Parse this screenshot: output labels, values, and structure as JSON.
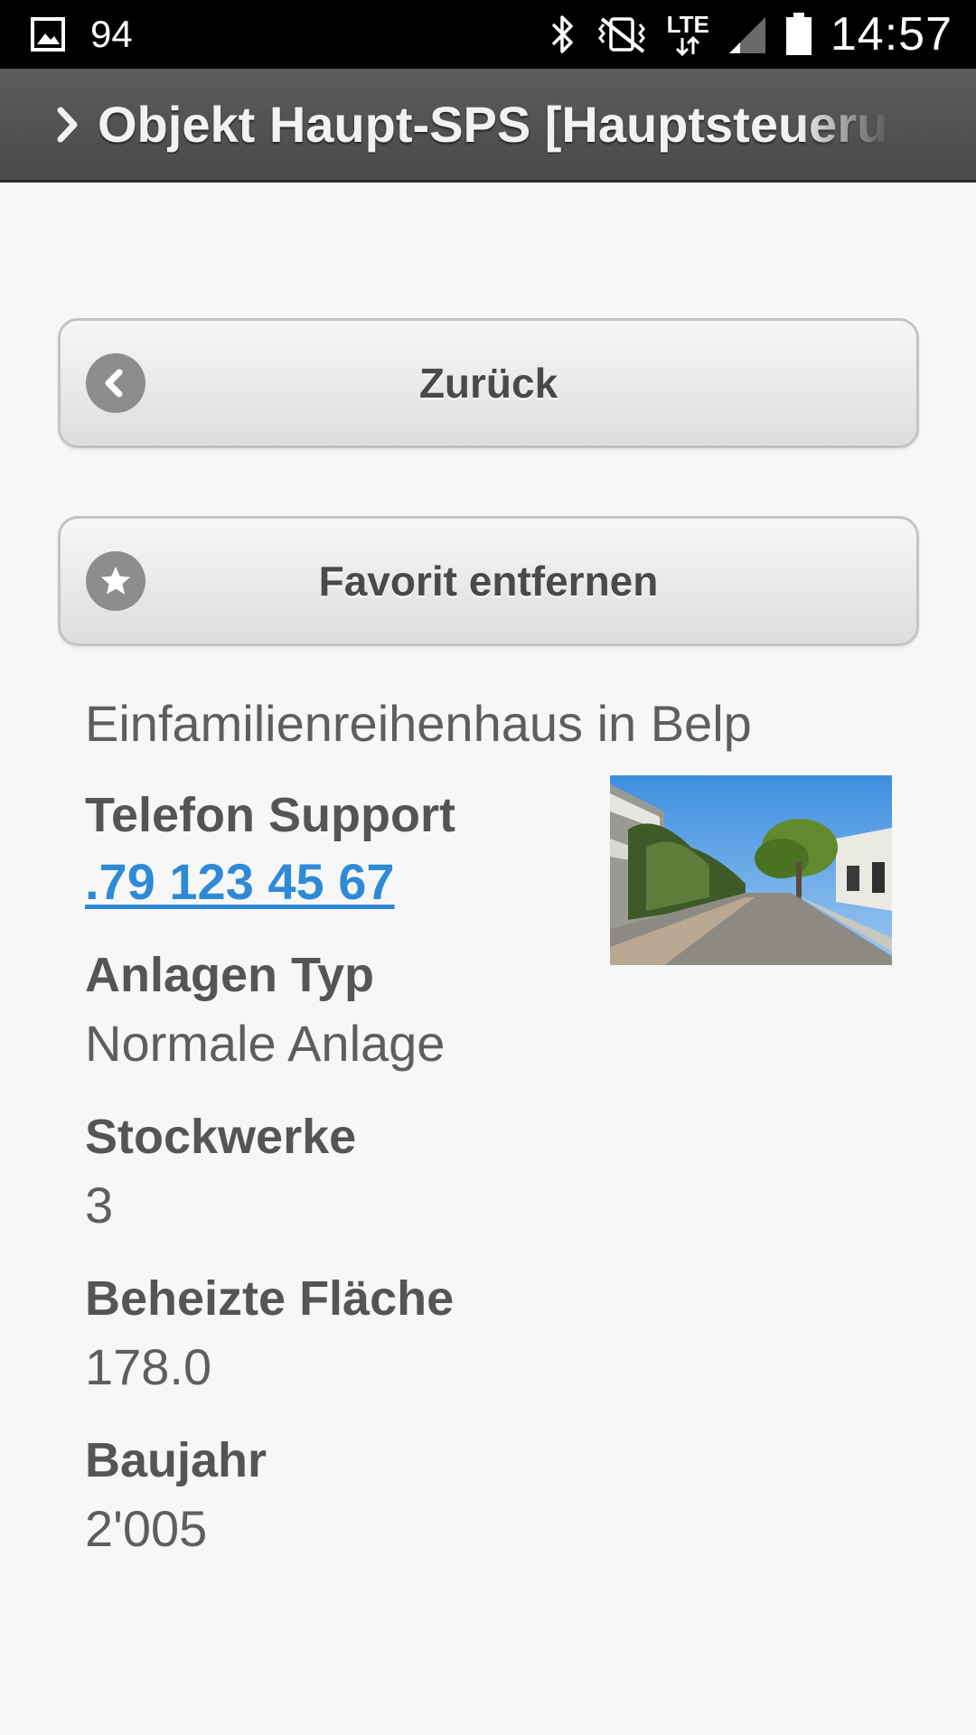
{
  "status_bar": {
    "notification_count": "94",
    "network": "LTE",
    "time": "14:57",
    "icons": [
      "gallery-icon",
      "bluetooth-icon",
      "vibrate-off-icon",
      "lte-icon",
      "signal-icon",
      "battery-icon"
    ]
  },
  "header": {
    "title": "Objekt Haupt-SPS [Hauptsteuerung]",
    "icon": "chevron-right-icon"
  },
  "buttons": {
    "back_label": "Zurück",
    "back_icon": "chevron-left-icon",
    "favorite_label": "Favorit entfernen",
    "favorite_icon": "star-icon"
  },
  "object": {
    "description": "Einfamilienreihenhaus in Belp",
    "photo_icon": "house-street-photo",
    "fields": [
      {
        "label": "Telefon Support",
        "value": ".79 123 45 67"
      },
      {
        "label": "Anlagen Typ",
        "value": "Normale Anlage"
      },
      {
        "label": "Stockwerke",
        "value": "3"
      },
      {
        "label": "Beheizte Fläche",
        "value": "178.0"
      },
      {
        "label": "Baujahr",
        "value": "2'005"
      }
    ]
  },
  "colors": {
    "header_bg": "#4f4f4f",
    "page_bg": "#f7f7f7",
    "link": "#2f8ad6",
    "button_icon_bg": "#8d8d8d"
  }
}
